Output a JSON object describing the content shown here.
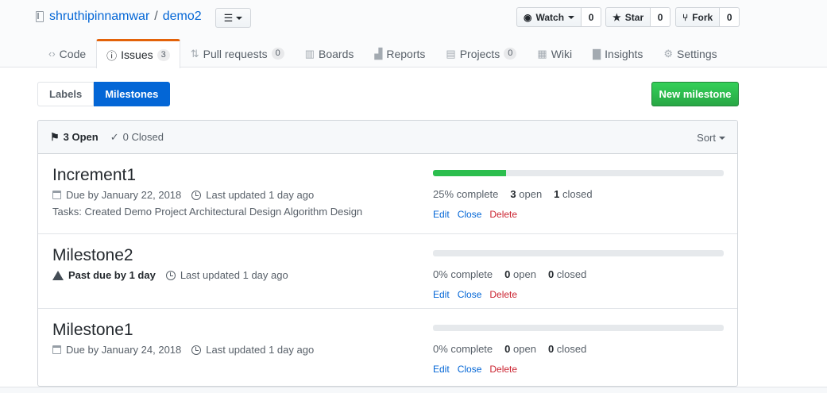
{
  "repo": {
    "owner": "shruthipinnamwar",
    "separator": "/",
    "name": "demo2"
  },
  "header_actions": [
    {
      "label": "Watch",
      "count": "0",
      "icon": "eye-icon"
    },
    {
      "label": "Star",
      "count": "0",
      "icon": "star-icon"
    },
    {
      "label": "Fork",
      "count": "0",
      "icon": "fork-icon"
    }
  ],
  "nav": {
    "tabs": [
      {
        "label": "Code",
        "icon": "code-icon"
      },
      {
        "label": "Issues",
        "counter": "3",
        "icon": "issue-icon",
        "selected": true
      },
      {
        "label": "Pull requests",
        "counter": "0",
        "icon": "pull-request-icon"
      },
      {
        "label": "Boards",
        "icon": "boards-icon"
      },
      {
        "label": "Reports",
        "icon": "reports-icon"
      },
      {
        "label": "Projects",
        "counter": "0",
        "icon": "projects-icon"
      },
      {
        "label": "Wiki",
        "icon": "wiki-icon"
      },
      {
        "label": "Insights",
        "icon": "insights-icon"
      },
      {
        "label": "Settings",
        "icon": "gear-icon"
      }
    ]
  },
  "subnav": {
    "labels": "Labels",
    "milestones": "Milestones"
  },
  "new_milestone": "New milestone",
  "filters": {
    "open": "3 Open",
    "closed": "0 Closed",
    "sort": "Sort"
  },
  "milestones": [
    {
      "title": "Increment1",
      "due": "Due by January 22, 2018",
      "updated": "Last updated 1 day ago",
      "description": "Tasks: Created Demo Project Architectural Design Algorithm Design",
      "progress": 25,
      "percent_label": "25% complete",
      "open_count": "3",
      "open_label": "open",
      "closed_count": "1",
      "closed_label": "closed",
      "edit": "Edit",
      "close": "Close",
      "delete": "Delete"
    },
    {
      "title": "Milestone2",
      "past_due": "Past due by 1 day",
      "updated": "Last updated 1 day ago",
      "progress": 0,
      "percent_label": "0% complete",
      "open_count": "0",
      "open_label": "open",
      "closed_count": "0",
      "closed_label": "closed",
      "edit": "Edit",
      "close": "Close",
      "delete": "Delete"
    },
    {
      "title": "Milestone1",
      "due": "Due by January 24, 2018",
      "updated": "Last updated 1 day ago",
      "progress": 0,
      "percent_label": "0% complete",
      "open_count": "0",
      "open_label": "open",
      "closed_count": "0",
      "closed_label": "closed",
      "edit": "Edit",
      "close": "Close",
      "delete": "Delete"
    }
  ],
  "colors": {
    "accent": "#0366d6",
    "primary": "#28a745",
    "progress": "#2cbe4e",
    "danger": "#cb2431",
    "selected_tab_border": "#e36209"
  }
}
